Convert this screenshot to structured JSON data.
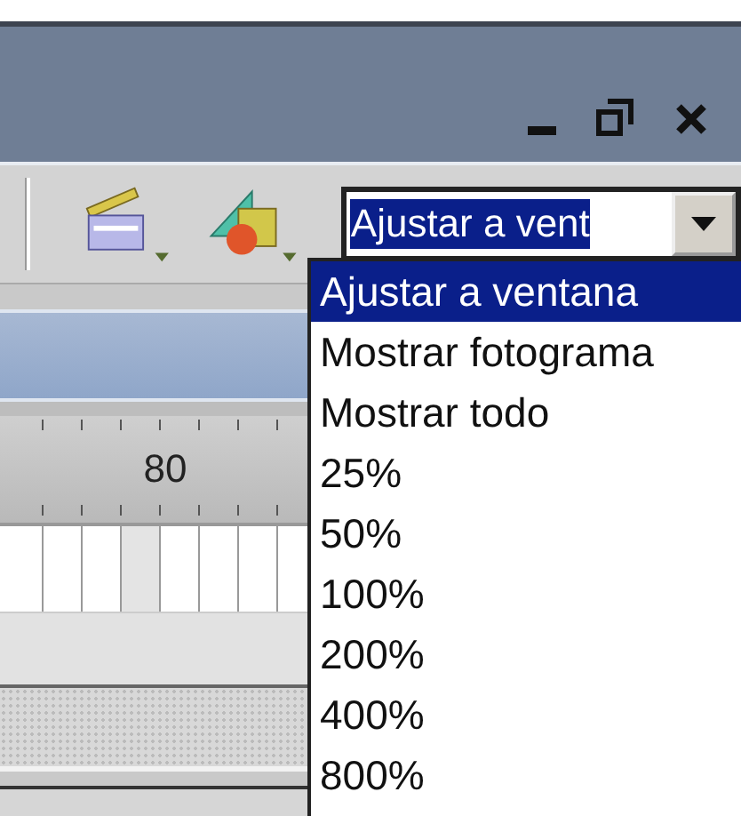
{
  "toolbar": {
    "zoom_combo": {
      "value": "Ajustar a vent",
      "expanded": true
    }
  },
  "zoom_options": [
    {
      "label": "Ajustar a ventana",
      "selected": true
    },
    {
      "label": "Mostrar fotograma",
      "selected": false
    },
    {
      "label": "Mostrar todo",
      "selected": false
    },
    {
      "label": "25%",
      "selected": false
    },
    {
      "label": "50%",
      "selected": false
    },
    {
      "label": "100%",
      "selected": false
    },
    {
      "label": "200%",
      "selected": false
    },
    {
      "label": "400%",
      "selected": false
    },
    {
      "label": "800%",
      "selected": false
    }
  ],
  "timeline": {
    "ruler_label": "80"
  }
}
